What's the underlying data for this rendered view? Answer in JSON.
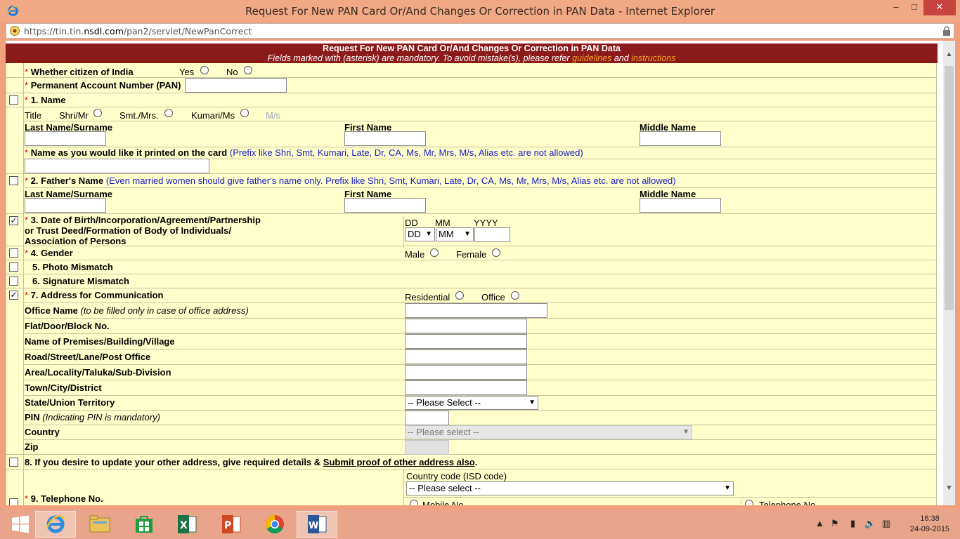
{
  "window": {
    "title": "Request For New PAN Card Or/And Changes Or Correction in PAN Data - Internet Explorer",
    "url_prefix": "https://tin.tin.",
    "url_domain": "nsdl.com",
    "url_path": "/pan2/servlet/NewPanCorrect"
  },
  "banner": {
    "title": "Request For New PAN Card Or/And Changes Or Correction in PAN Data",
    "sub_prefix": "Fields marked with",
    "sub_middle": " (asterisk) are mandatory.   To avoid mistake(s), please refer ",
    "guidelines_link": "guidelines",
    "and_text": " and ",
    "instructions_link": "instructions"
  },
  "form": {
    "asterisk": "*",
    "citizen_label": "Whether citizen of India",
    "yes": "Yes",
    "no": "No",
    "pan_label": "Permanent Account Number (PAN)",
    "name_label": "1. Name",
    "title_label": "Title",
    "shri": "Shri/Mr",
    "smt": "Smt./Mrs.",
    "kumari": "Kumari/Ms",
    "ms": "M/s",
    "last_name": "Last Name/Surname",
    "first_name": "First Name",
    "middle_name": "Middle Name",
    "print_name_label": "Name as you would like it printed on the card",
    "print_name_note": "(Prefix like Shri, Smt, Kumari, Late, Dr, CA, Ms, Mr, Mrs, M/s, Alias etc. are not allowed)",
    "father_label": "2. Father's Name",
    "father_note": "(Even married women should give father's name only. Prefix like Shri, Smt, Kumari, Late, Dr, CA, Ms, Mr, Mrs, M/s, Alias etc. are not allowed)",
    "dob_line1": "3. Date of Birth/Incorporation/Agreement/Partnership",
    "dob_line2": "or Trust Deed/Formation of Body of Individuals/",
    "dob_line3": "Association of Persons",
    "dd": "DD",
    "mm": "MM",
    "yyyy": "YYYY",
    "dd_select": "DD",
    "mm_select": "MM",
    "gender_label": "4. Gender",
    "male": "Male",
    "female": "Female",
    "photo_label": "5. Photo Mismatch",
    "signature_label": "6. Signature Mismatch",
    "address_label": "7. Address for Communication",
    "residential": "Residential",
    "office": "Office",
    "office_name": "Office Name",
    "office_name_note": "(to be filled only in case of office address)",
    "flat": "Flat/Door/Block No.",
    "premises": "Name of Premises/Building/Village",
    "road": "Road/Street/Lane/Post Office",
    "area": "Area/Locality/Taluka/Sub-Division",
    "town": "Town/City/District",
    "state": "State/Union Territory",
    "state_select": "-- Please Select --",
    "pin": "PIN",
    "pin_note": "(Indicating PIN is mandatory)",
    "country": "Country",
    "country_select": "-- Please select --",
    "zip": "Zip",
    "other_address_prefix": "8. If you desire to update your other address, give required details & ",
    "other_address_link": "Submit proof of other address also",
    "other_address_suffix": ".",
    "isd_label": "Country code (ISD code)",
    "isd_select": "-- Please select --",
    "telephone_label": "9. Telephone No.",
    "mobile_no": "Mobile No.",
    "telephone_no": "Telephone No."
  },
  "taskbar": {
    "time": "16:38",
    "date": "24-09-2015"
  }
}
